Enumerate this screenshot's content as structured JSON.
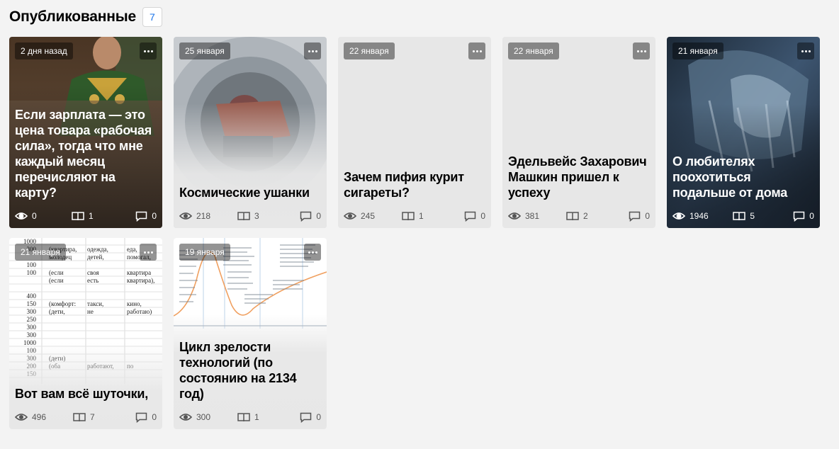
{
  "header": {
    "title": "Опубликованные",
    "count": "7"
  },
  "cards": [
    {
      "date": "2 дня назад",
      "title": "Если зарплата — это цена товара «рабочая сила», тогда что мне каждый месяц перечисляют на карту?",
      "views": "0",
      "reads": "1",
      "comments": "0"
    },
    {
      "date": "25 января",
      "title": "Космические ушанки",
      "views": "218",
      "reads": "3",
      "comments": "0"
    },
    {
      "date": "22 января",
      "title": "Зачем пифия курит сигареты?",
      "views": "245",
      "reads": "1",
      "comments": "0"
    },
    {
      "date": "22 января",
      "title": "Эдельвейс Захарович Машкин пришел к успеху",
      "views": "381",
      "reads": "2",
      "comments": "0"
    },
    {
      "date": "21 января",
      "title": "О любителях поохотиться подальше от дома",
      "views": "1946",
      "reads": "5",
      "comments": "0"
    },
    {
      "date": "21 января",
      "title": "Вот вам всё шуточки,",
      "views": "496",
      "reads": "7",
      "comments": "0"
    },
    {
      "date": "19 января",
      "title": "Цикл зрелости технологий (по состоянию на 2134 год)",
      "views": "300",
      "reads": "1",
      "comments": "0"
    }
  ],
  "colors": {
    "accent": "#1a73e8",
    "background": "#f3f3f3",
    "card": "#e7e7e7"
  },
  "icons": [
    "eye-icon",
    "book-icon",
    "comment-icon",
    "more-icon"
  ],
  "table_snippet": {
    "rows": [
      [
        "1000",
        "",
        "",
        ""
      ],
      [
        "300",
        "(квартира,",
        "одежда,",
        "еда,"
      ],
      [
        "",
        "молодец",
        "детей,",
        "помогал,"
      ],
      [
        "100",
        "",
        "",
        ""
      ],
      [
        "100",
        "(если",
        "своя",
        "квартира"
      ],
      [
        "",
        "(если",
        "есть",
        "квартира),"
      ],
      [
        "",
        "",
        "",
        ""
      ],
      [
        "400",
        "",
        "",
        ""
      ],
      [
        "150",
        "(комфорт:",
        "такси,",
        "кино,"
      ],
      [
        "300",
        "(дети,",
        "не",
        "работаю)"
      ],
      [
        "250",
        "",
        "",
        ""
      ],
      [
        "300",
        "",
        "",
        ""
      ],
      [
        "300",
        "",
        "",
        ""
      ],
      [
        "1000",
        "",
        "",
        ""
      ],
      [
        "100",
        "",
        "",
        ""
      ],
      [
        "300",
        "(дети)",
        "",
        ""
      ],
      [
        "200",
        "(оба",
        "работают,",
        "по"
      ],
      [
        "150",
        "",
        "",
        ""
      ]
    ]
  }
}
